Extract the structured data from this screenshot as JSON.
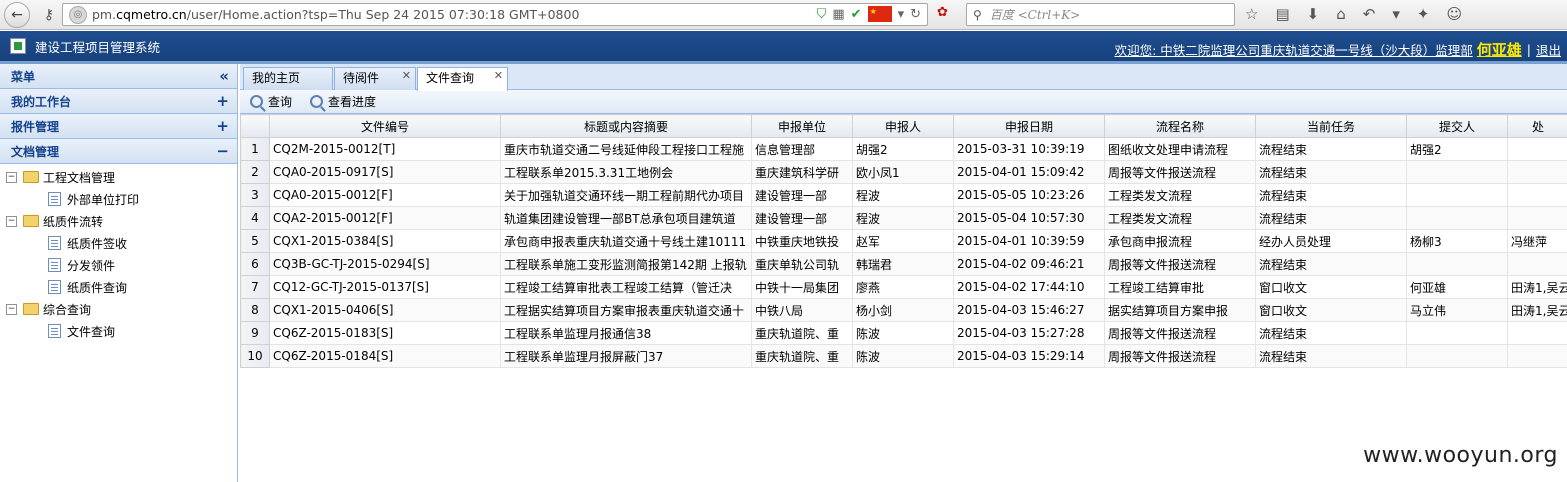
{
  "browser": {
    "url_prefix": "pm.",
    "url_domain": "cqmetro.cn",
    "url_rest": "/user/Home.action?tsp=Thu Sep 24 2015 07:30:18 GMT+0800",
    "search_placeholder": "百度 <Ctrl+K>"
  },
  "app": {
    "title": "建设工程项目管理系统",
    "welcome_prefix": "欢迎您: 中铁二院监理公司重庆轨道交通一号线（沙大段）监理部",
    "user_name": "何亚雄",
    "separator": "|",
    "logout": "退出"
  },
  "sidebar": {
    "menu_title": "菜单",
    "collapse_glyph": "«",
    "sections": [
      {
        "label": "我的工作台",
        "glyph": "+"
      },
      {
        "label": "报件管理",
        "glyph": "+"
      },
      {
        "label": "文档管理",
        "glyph": "−"
      }
    ],
    "tree": [
      {
        "label": "工程文档管理",
        "type": "folder"
      },
      {
        "label": "外部单位打印",
        "type": "doc"
      },
      {
        "label": "纸质件流转",
        "type": "folder"
      },
      {
        "label": "纸质件签收",
        "type": "doc"
      },
      {
        "label": "分发领件",
        "type": "doc"
      },
      {
        "label": "纸质件查询",
        "type": "doc"
      },
      {
        "label": "综合查询",
        "type": "folder"
      },
      {
        "label": "文件查询",
        "type": "doc"
      }
    ]
  },
  "tabs": [
    {
      "label": "我的主页"
    },
    {
      "label": "待阅件"
    },
    {
      "label": "文件查询"
    }
  ],
  "toolbar": {
    "query": "查询",
    "progress": "查看进度"
  },
  "grid": {
    "columns": [
      "文件编号",
      "标题或内容摘要",
      "申报单位",
      "申报人",
      "申报日期",
      "流程名称",
      "当前任务",
      "提交人",
      "处"
    ],
    "rows": [
      [
        "1",
        "CQ2M-2015-0012[T]",
        "重庆市轨道交通二号线延伸段工程接口工程施",
        "信息管理部",
        "胡强2",
        "2015-03-31 10:39:19",
        "图纸收文处理申请流程",
        "流程结束",
        "胡强2",
        ""
      ],
      [
        "2",
        "CQA0-2015-0917[S]",
        "工程联系单2015.3.31工地例会",
        "重庆建筑科学研",
        "欧小凤1",
        "2015-04-01 15:09:42",
        "周报等文件报送流程",
        "流程结束",
        "",
        ""
      ],
      [
        "3",
        "CQA0-2015-0012[F]",
        "关于加强轨道交通环线一期工程前期代办项目",
        "建设管理一部",
        "程波",
        "2015-05-05 10:23:26",
        "工程类发文流程",
        "流程结束",
        "",
        ""
      ],
      [
        "4",
        "CQA2-2015-0012[F]",
        "轨道集团建设管理一部BT总承包项目建筑道",
        "建设管理一部",
        "程波",
        "2015-05-04 10:57:30",
        "工程类发文流程",
        "流程结束",
        "",
        ""
      ],
      [
        "5",
        "CQX1-2015-0384[S]",
        "承包商申报表重庆轨道交通十号线土建10111",
        "中铁重庆地铁投",
        "赵军",
        "2015-04-01 10:39:59",
        "承包商申报流程",
        "经办人员处理",
        "杨柳3",
        "冯继萍"
      ],
      [
        "6",
        "CQ3B-GC-TJ-2015-0294[S]",
        "工程联系单施工变形监测简报第142期 上报轨",
        "重庆单轨公司轨",
        "韩瑞君",
        "2015-04-02 09:46:21",
        "周报等文件报送流程",
        "流程结束",
        "",
        ""
      ],
      [
        "7",
        "CQ12-GC-TJ-2015-0137[S]",
        "工程竣工结算审批表工程竣工结算（管迁决",
        "中铁十一局集团",
        "廖燕",
        "2015-04-02 17:44:10",
        "工程竣工结算审批",
        "窗口收文",
        "何亚雄",
        "田涛1,吴云"
      ],
      [
        "8",
        "CQX1-2015-0406[S]",
        "工程据实结算项目方案审报表重庆轨道交通十",
        "中铁八局",
        "杨小剑",
        "2015-04-03 15:46:27",
        "据实结算项目方案申报",
        "窗口收文",
        "马立伟",
        "田涛1,吴云"
      ],
      [
        "9",
        "CQ6Z-2015-0183[S]",
        "工程联系单监理月报通信38",
        "重庆轨道院、重",
        "陈波",
        "2015-04-03 15:27:28",
        "周报等文件报送流程",
        "流程结束",
        "",
        ""
      ],
      [
        "10",
        "CQ6Z-2015-0184[S]",
        "工程联系单监理月报屏蔽门37",
        "重庆轨道院、重",
        "陈波",
        "2015-04-03 15:29:14",
        "周报等文件报送流程",
        "流程结束",
        "",
        ""
      ]
    ]
  },
  "watermark": "www.wooyun.org"
}
